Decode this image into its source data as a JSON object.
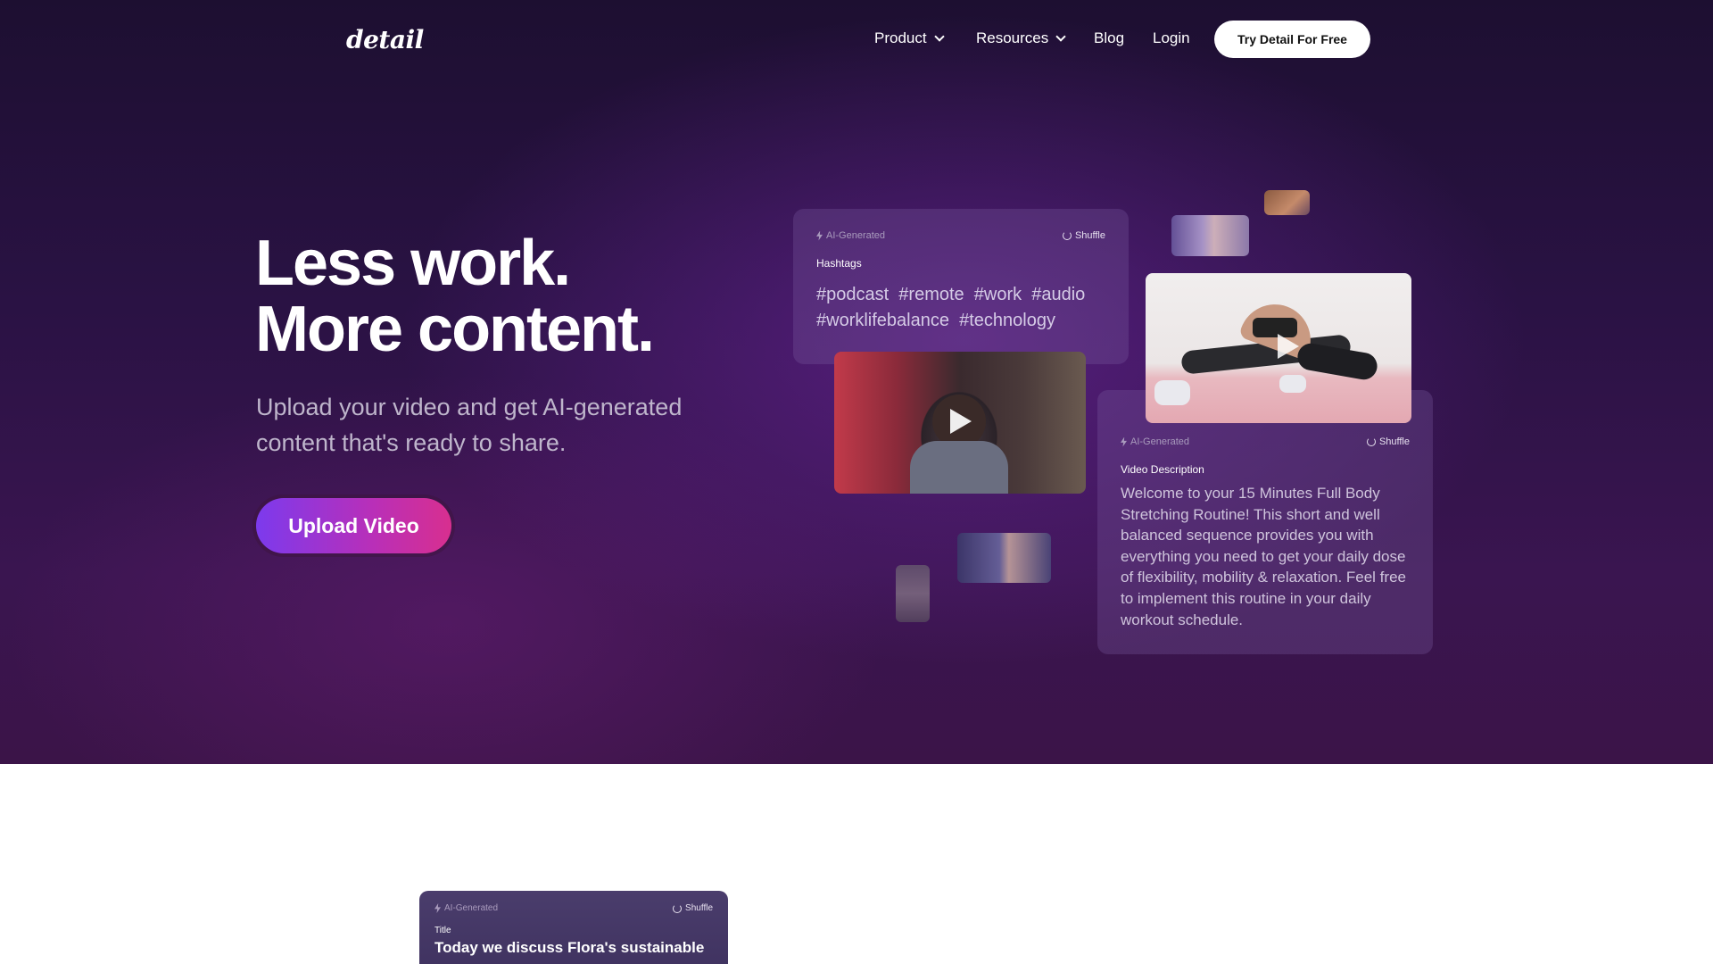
{
  "nav": {
    "logo": "detail",
    "items": [
      "Product",
      "Resources",
      "Blog",
      "Login"
    ],
    "cta": "Try Detail For Free"
  },
  "hero": {
    "headline_line1": "Less work.",
    "headline_line2": "More content.",
    "subtitle": "Upload your video and get AI-generated content that's ready to share.",
    "button": "Upload Video"
  },
  "hashtags_card": {
    "badge": "AI-Generated",
    "shuffle": "Shuffle",
    "label": "Hashtags",
    "tags_line1": "#podcast  #remote  #work  #audio",
    "tags_line2": "#worklifebalance  #technology"
  },
  "description_card": {
    "badge": "AI-Generated",
    "shuffle": "Shuffle",
    "label": "Video Description",
    "text": "Welcome to your 15 Minutes Full Body Stretching Routine! This short and well balanced sequence provides you with everything you need to get your daily dose of flexibility, mobility & relaxation. Feel free to implement this routine in your daily workout schedule."
  },
  "title_card": {
    "badge": "AI-Generated",
    "shuffle": "Shuffle",
    "label": "Title",
    "text": "Today we discuss Flora's sustainable"
  },
  "colors": {
    "accent_start": "#7c3aed",
    "accent_end": "#d82f8f",
    "hero_bg": "#2a1244"
  }
}
